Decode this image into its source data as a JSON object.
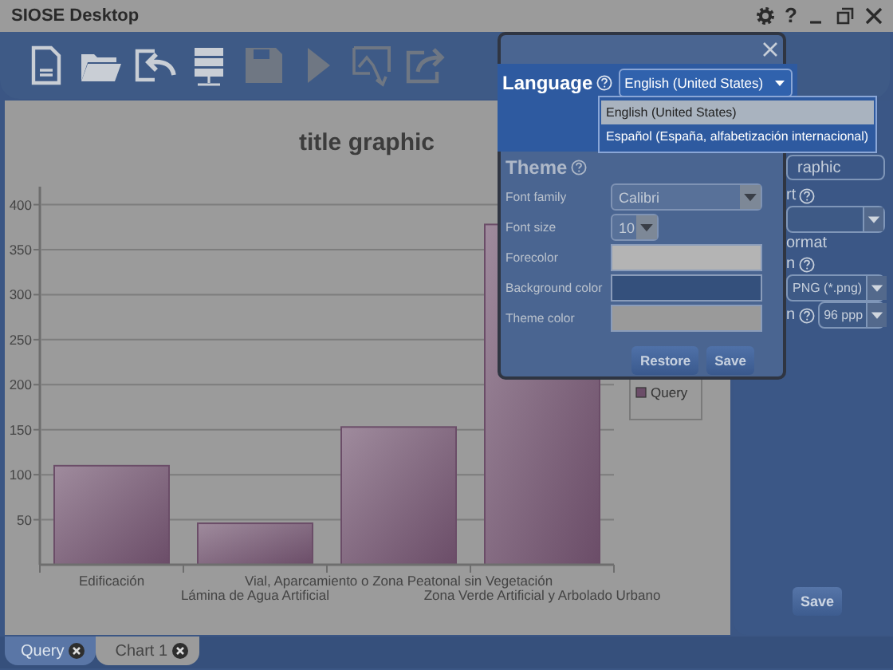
{
  "window": {
    "title": "SIOSE Desktop",
    "help_label": "?"
  },
  "toolbar": [
    {
      "kind": "new",
      "disabled": false
    },
    {
      "kind": "open",
      "disabled": false
    },
    {
      "kind": "import",
      "disabled": false
    },
    {
      "kind": "server",
      "disabled": false
    },
    {
      "kind": "save",
      "disabled": true
    },
    {
      "kind": "run",
      "disabled": true
    },
    {
      "kind": "export-chart",
      "disabled": true
    },
    {
      "kind": "share",
      "disabled": true
    }
  ],
  "chart": {
    "chart_data": {
      "type": "bar",
      "title": "title graphic",
      "categories": [
        "Edificación",
        "Lámina de Agua Artificial",
        "Vial, Aparcamiento o Zona Peatonal sin Vegetación",
        "Zona Verde Artificial y Arbolado Urbano"
      ],
      "series": [
        {
          "name": "Query",
          "color": "#6b4d68",
          "values": [
            110,
            46,
            153,
            378
          ]
        }
      ],
      "ylim": [
        0,
        420
      ],
      "grid": true,
      "yticks": [
        50,
        100,
        150,
        200,
        250,
        300,
        350,
        400
      ]
    }
  },
  "side_panel": {
    "items": [
      {
        "kind": "field",
        "value": "raphic"
      },
      {
        "kind": "label",
        "text": "rt",
        "help": true
      },
      {
        "kind": "select"
      },
      {
        "kind": "label",
        "text": "ormat",
        "help": false
      },
      {
        "kind": "label",
        "text": "n",
        "help": true
      },
      {
        "kind": "select",
        "value": "PNG (*.png)"
      },
      {
        "kind": "label-select",
        "text": "n",
        "help": true,
        "value": "96 ppp"
      }
    ],
    "save_button": "Save"
  },
  "tabs": [
    {
      "label": "Query",
      "selected": true
    },
    {
      "label": "Chart 1",
      "selected": false
    }
  ],
  "dialog": {
    "language": {
      "label": "Language",
      "help": true,
      "value": "English (United States)",
      "options": [
        {
          "label": "English (United States)",
          "selected": true
        },
        {
          "label": "Español (España, alfabetización internacional)",
          "selected": false
        }
      ]
    },
    "theme": {
      "title": "Theme",
      "help": true,
      "rows": [
        {
          "kind": "select",
          "label": "Font family",
          "value": "Calibri"
        },
        {
          "kind": "select",
          "label": "Font size",
          "value": "10"
        },
        {
          "kind": "color",
          "label": "Forecolor",
          "color": "#b4b4b4"
        },
        {
          "kind": "color",
          "label": "Background color",
          "color": "#34507c"
        },
        {
          "kind": "color",
          "label": "Theme color",
          "color": "#9a9a9a"
        }
      ]
    },
    "buttons": [
      "Restore",
      "Save"
    ]
  }
}
